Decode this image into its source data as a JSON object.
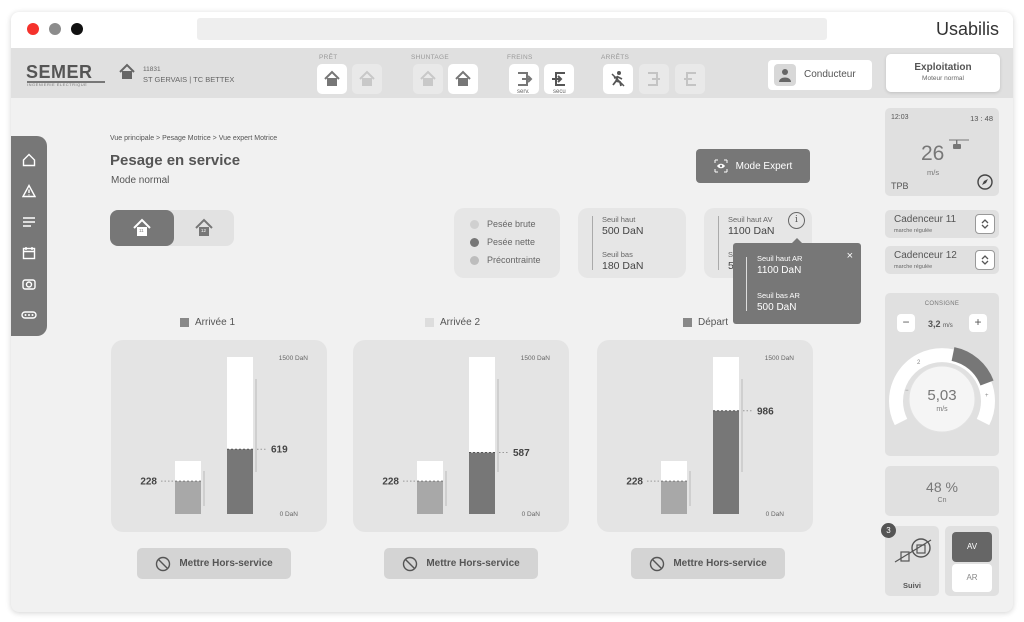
{
  "window": {
    "app_name": "Usabilis"
  },
  "header": {
    "logo": "SEMER",
    "logo_sub": "INGÉNIERIE ÉLECTRIQUE",
    "site_code": "11831",
    "site_name": "ST GERVAIS | TC BETTEX",
    "groups": {
      "pret": "PRÊT",
      "shuntage": "SHUNTAGE",
      "freins": "FREINS",
      "arrets": "ARRÊTS"
    },
    "freins_labels": [
      "serv.",
      "secu"
    ],
    "conducteur": "Conducteur",
    "exploitation": {
      "title": "Exploitation",
      "sub": "Moteur normal"
    }
  },
  "breadcrumb": "Vue principale > Pesage Motrice > Vue expert Motrice",
  "page": {
    "title": "Pesage en service",
    "mode": "Mode normal",
    "mode_expert": "Mode Expert"
  },
  "segment": {
    "items": [
      "11",
      "12"
    ]
  },
  "legend": [
    {
      "label": "Pesée brute",
      "color": "#d0d0d0"
    },
    {
      "label": "Pesée nette",
      "color": "#777777"
    },
    {
      "label": "Précontrainte",
      "color": "#bdbdbd"
    }
  ],
  "seuils": {
    "card1": {
      "haut_label": "Seuil haut",
      "haut_value": "500 DaN",
      "bas_label": "Seuil bas",
      "bas_value": "180 DaN"
    },
    "card2": {
      "haut_label": "Seuil haut AV",
      "haut_value": "1100 DaN",
      "bas_label": "S",
      "bas_value": "5"
    }
  },
  "tooltip": {
    "haut_label": "Seuil haut AR",
    "haut_value": "1100 DaN",
    "bas_label": "Seuil bas AR",
    "bas_value": "500 DaN"
  },
  "chart_data": [
    {
      "type": "bar",
      "title": "Arrivée 1",
      "ylim": [
        0,
        1500
      ],
      "max_label": "1500 DaN",
      "min_label": "0 DaN",
      "small": 228,
      "large": 619,
      "small_label": "228",
      "large_label": "619"
    },
    {
      "type": "bar",
      "title": "Arrivée 2",
      "ylim": [
        0,
        1500
      ],
      "max_label": "1500 DaN",
      "min_label": "0 DaN",
      "small": 228,
      "large": 587,
      "small_label": "228",
      "large_label": "587"
    },
    {
      "type": "bar",
      "title": "Départ",
      "ylim": [
        0,
        1500
      ],
      "max_label": "1500 DaN",
      "min_label": "0 DaN",
      "small": 228,
      "large": 986,
      "small_label": "228",
      "large_label": "986"
    }
  ],
  "chart_title_colors": [
    "#888888",
    "#dddddd",
    "#888888"
  ],
  "hors_service": "Mettre Hors-service",
  "right": {
    "time": "12:03",
    "time2": "13 : 48",
    "speed": "26",
    "speed_unit": "m/s",
    "tpb": "TPB",
    "cadenceurs": [
      {
        "title": "Cadenceur 11",
        "sub": "marche régulée"
      },
      {
        "title": "Cadenceur 12",
        "sub": "marche régulée"
      }
    ],
    "consigne": {
      "label": "CONSIGNE",
      "value": "3,2",
      "unit": "m/s",
      "minus": "−",
      "plus": "+"
    },
    "gauge": {
      "value": "5,03",
      "unit": "m/s",
      "tick_left": "−",
      "tick_right": "+",
      "tick_top": "2"
    },
    "cn": {
      "value": "48 %",
      "label": "Cn"
    },
    "suivi": {
      "badge": "3",
      "label": "Suivi"
    },
    "dir": {
      "av": "AV",
      "ar": "AR"
    }
  }
}
